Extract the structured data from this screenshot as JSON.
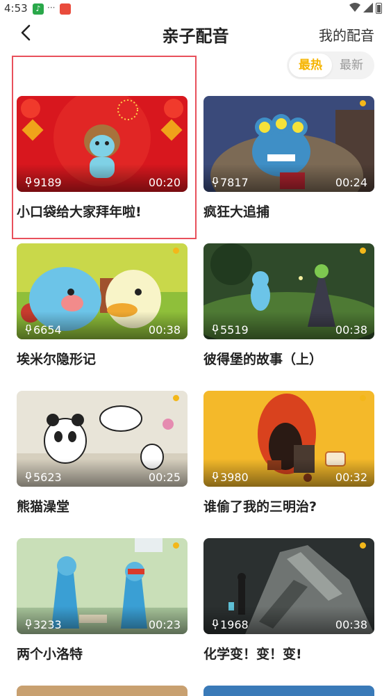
{
  "status_bar": {
    "time": "4:53",
    "icon_count_text": "···"
  },
  "header": {
    "title": "亲子配音",
    "my_dubbing": "我的配音"
  },
  "sort_tabs": {
    "hot": "最热",
    "latest": "最新",
    "active": "hot"
  },
  "colors": {
    "accent": "#f5b400",
    "selection": "#e8505b"
  },
  "videos": [
    {
      "title": "小口袋给大家拜年啦!",
      "plays": "9189",
      "duration": "00:20",
      "selected": true
    },
    {
      "title": "疯狂大追捕",
      "plays": "7817",
      "duration": "00:24"
    },
    {
      "title": "埃米尔隐形记",
      "plays": "6654",
      "duration": "00:38"
    },
    {
      "title": "彼得堡的故事（上）",
      "plays": "5519",
      "duration": "00:38"
    },
    {
      "title": "熊猫澡堂",
      "plays": "5623",
      "duration": "00:25"
    },
    {
      "title": "谁偷了我的三明治?",
      "plays": "3980",
      "duration": "00:32"
    },
    {
      "title": "两个小洛特",
      "plays": "3233",
      "duration": "00:23"
    },
    {
      "title": "化学变！变！变!",
      "plays": "1968",
      "duration": "00:38"
    }
  ]
}
